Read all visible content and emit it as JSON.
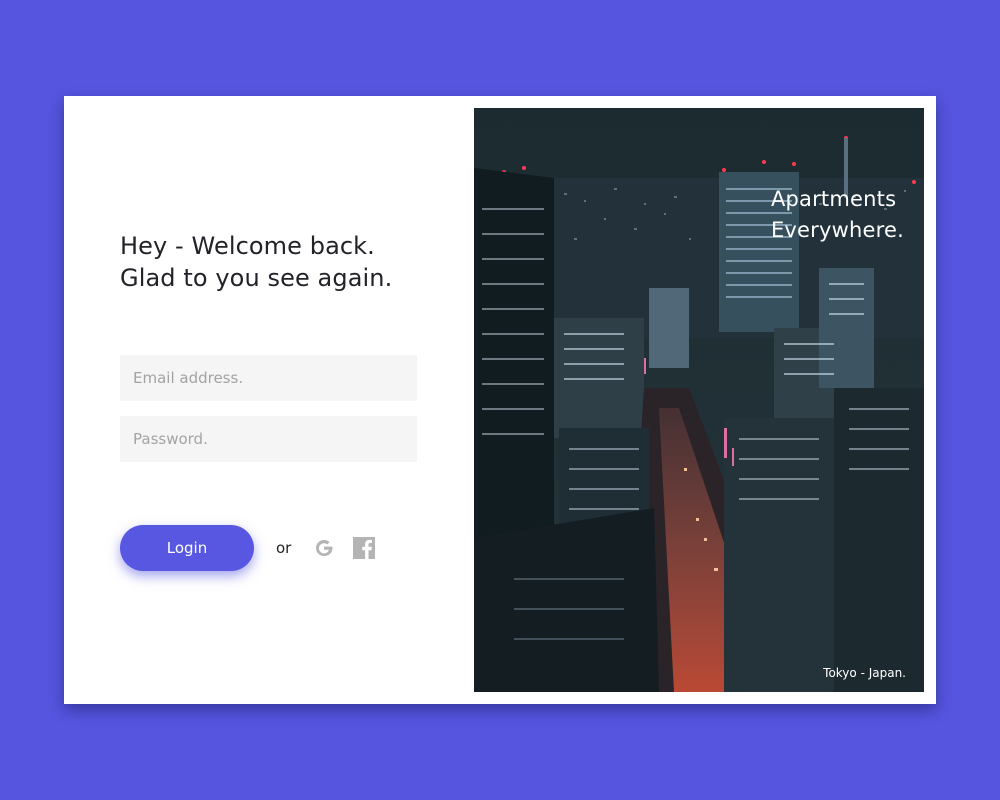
{
  "welcome": {
    "line1": "Hey - Welcome back.",
    "line2": "Glad to you see again."
  },
  "form": {
    "email_placeholder": "Email address.",
    "password_placeholder": "Password.",
    "login_label": "Login",
    "or_label": "or"
  },
  "social": [
    "google-icon",
    "facebook-icon"
  ],
  "hero": {
    "tagline_line1": "Apartments",
    "tagline_line2": "Everywhere.",
    "caption": "Tokyo - Japan."
  },
  "colors": {
    "background": "#5555e0",
    "accent": "#5757e2",
    "input_bg": "#f5f5f5",
    "icon_gray": "#b4b4b4"
  }
}
